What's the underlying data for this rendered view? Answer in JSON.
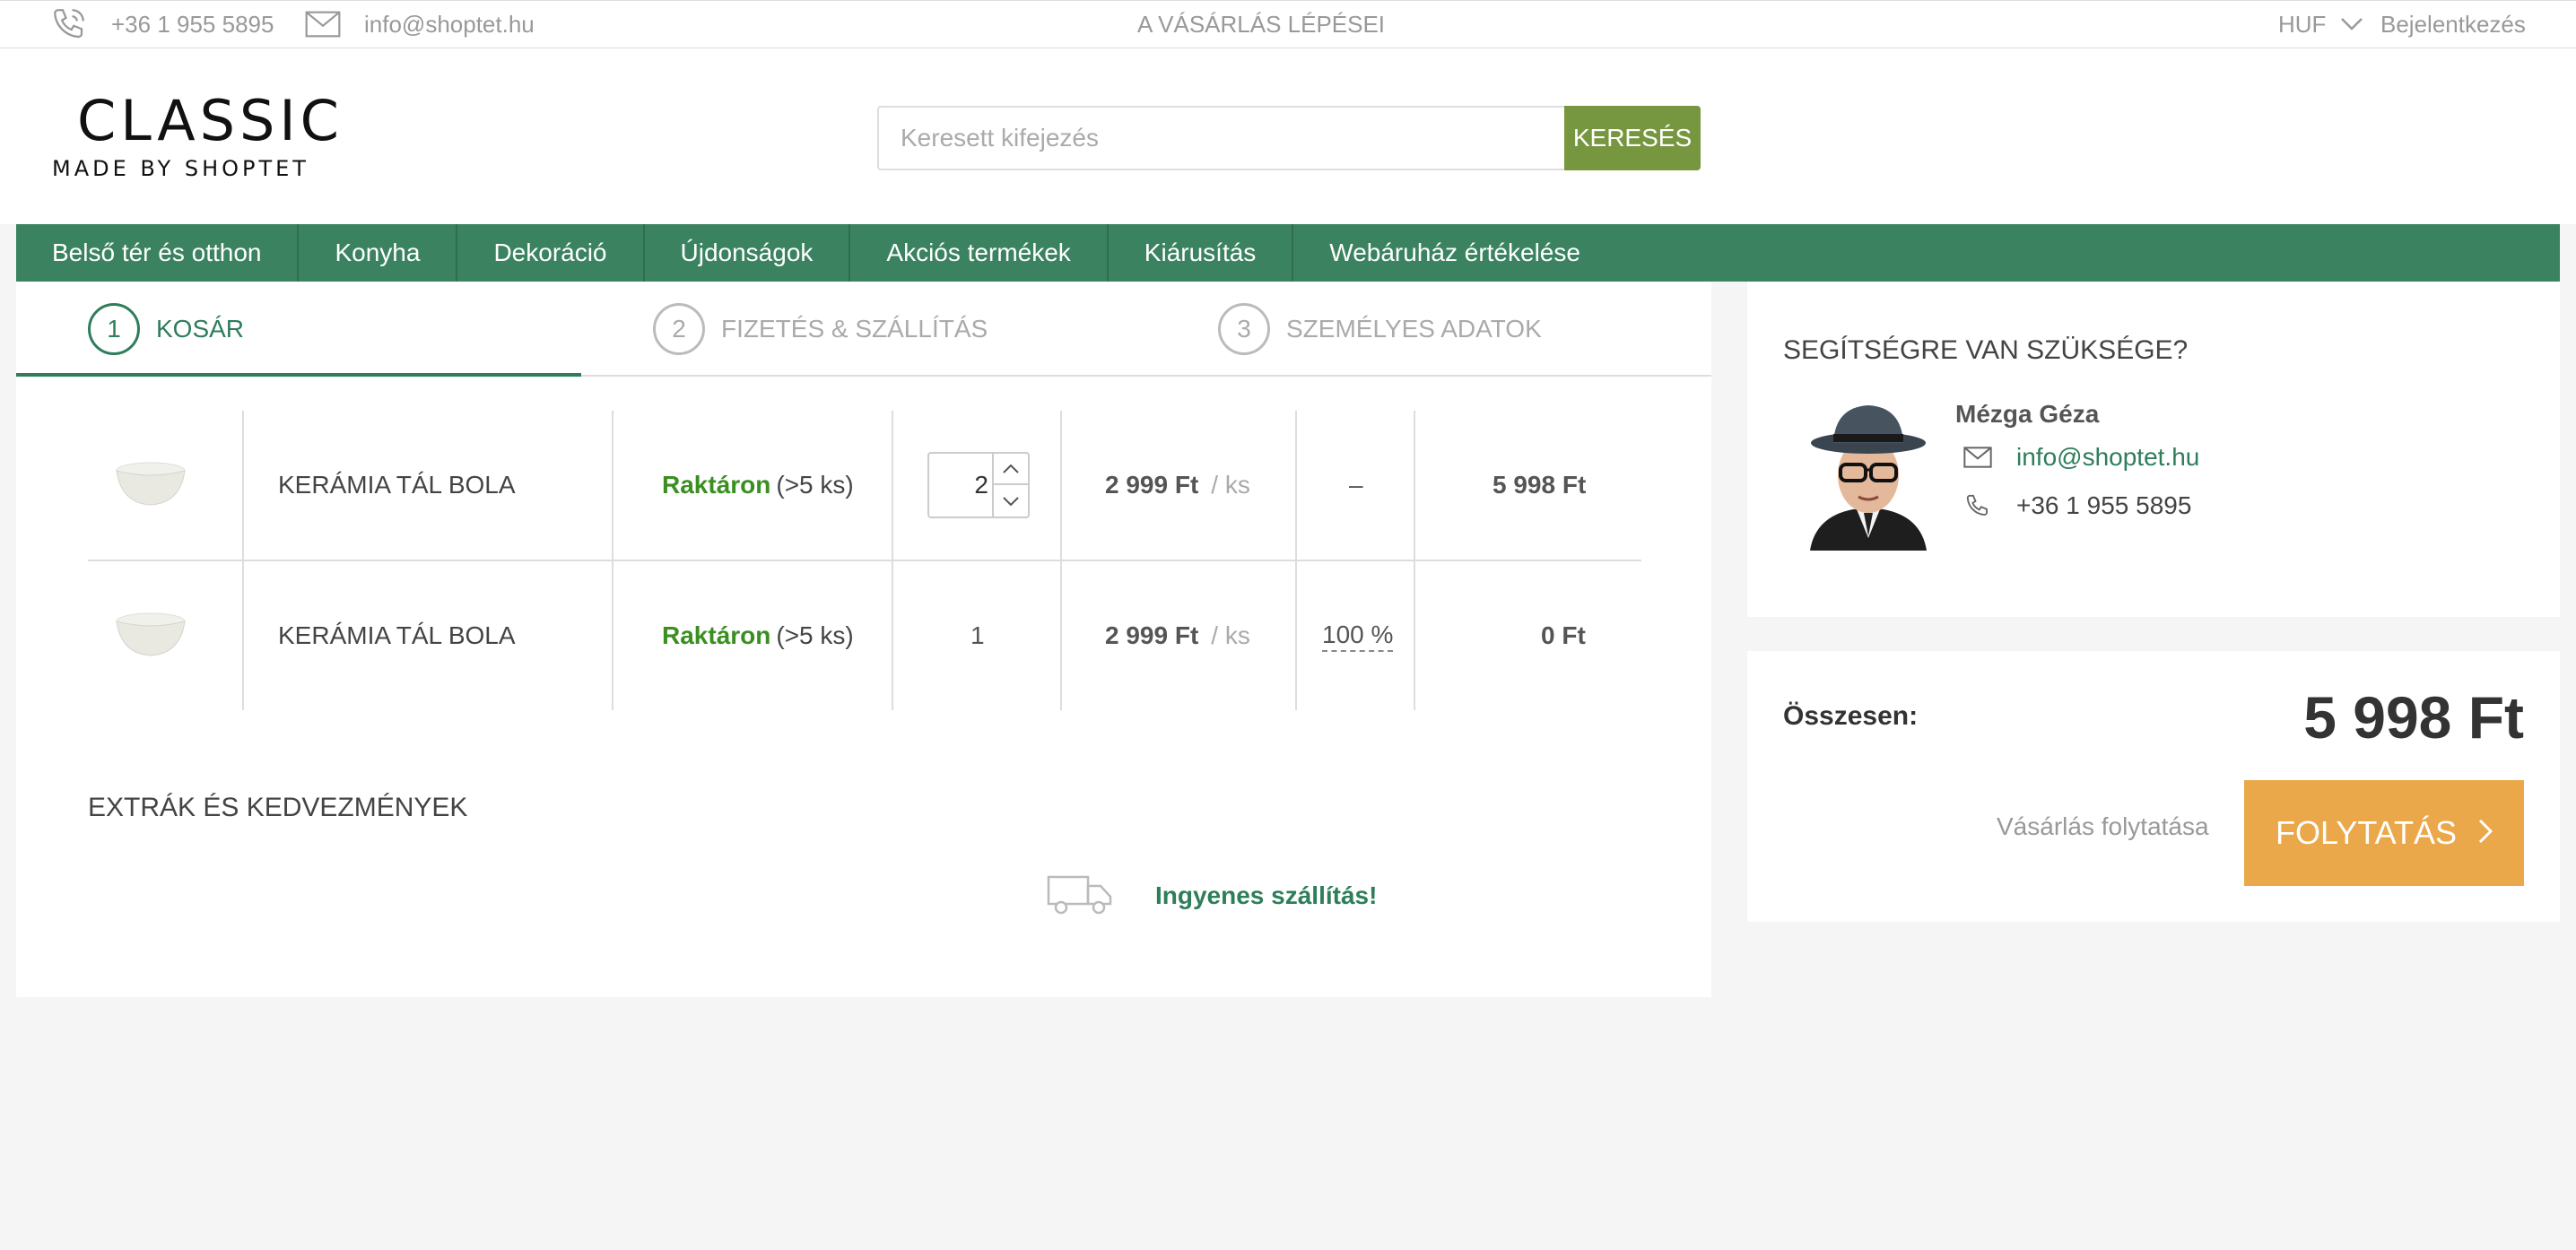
{
  "topbar": {
    "phone": "+36 1 955 5895",
    "email": "info@shoptet.hu",
    "steps_link": "A VÁSÁRLÁS LÉPÉSEI",
    "currency": "HUF",
    "login": "Bejelentkezés"
  },
  "header": {
    "logo_main": "CLASSIC",
    "logo_sub": "MADE BY SHOPTET",
    "search_placeholder": "Keresett kifejezés",
    "search_button": "KERESÉS"
  },
  "nav": {
    "items": [
      "Belső tér és otthon",
      "Konyha",
      "Dekoráció",
      "Újdonságok",
      "Akciós termékek",
      "Kiárusítás",
      "Webáruház értékelése"
    ]
  },
  "steps": [
    {
      "num": "1",
      "label": "KOSÁR"
    },
    {
      "num": "2",
      "label": "FIZETÉS & SZÁLLÍTÁS"
    },
    {
      "num": "3",
      "label": "SZEMÉLYES ADATOK"
    }
  ],
  "cart": {
    "rows": [
      {
        "name": "KERÁMIA TÁL BOLA",
        "stock": "Raktáron",
        "stock_note": "(>5 ks)",
        "qty": "2",
        "price": "2 999 Ft",
        "unit": "/ ks",
        "discount": "–",
        "total": "5 998 Ft"
      },
      {
        "name": "KERÁMIA TÁL BOLA",
        "stock": "Raktáron",
        "stock_note": "(>5 ks)",
        "qty": "1",
        "price": "2 999 Ft",
        "unit": "/ ks",
        "discount": "100 %",
        "total": "0 Ft"
      }
    ]
  },
  "extras": {
    "title": "EXTRÁK ÉS KEDVEZMÉNYEK",
    "free_shipping": "Ingyenes szállítás!"
  },
  "help": {
    "title": "SEGÍTSÉGRE VAN SZÜKSÉGE?",
    "name": "Mézga Géza",
    "email": "info@shoptet.hu",
    "phone": "+36 1 955 5895"
  },
  "summary": {
    "label": "Összesen:",
    "total": "5 998 Ft",
    "continue_shopping": "Vásárlás folytatása",
    "next_button": "FOLYTATÁS"
  },
  "colors": {
    "brand_green": "#3b8360",
    "search_green": "#76973f",
    "accent_orange": "#eba84a",
    "stock_green": "#3a8f20"
  }
}
